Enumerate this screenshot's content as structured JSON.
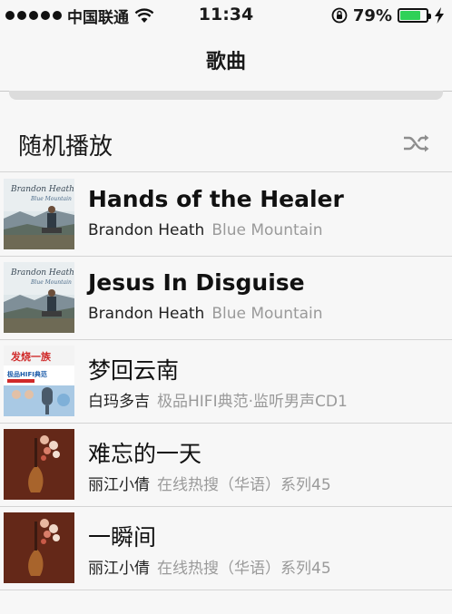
{
  "status_bar": {
    "carrier": "中国联通",
    "time": "11:34",
    "battery_percent": "79%",
    "battery_level": 0.79,
    "signal_dots": 5,
    "icons": [
      "signal-dots-icon",
      "wifi-icon",
      "rotation-lock-icon",
      "battery-icon",
      "charging-bolt-icon"
    ]
  },
  "nav": {
    "title": "歌曲"
  },
  "shuffle": {
    "label": "随机播放",
    "icon": "shuffle-icon"
  },
  "songs": [
    {
      "title": "Hands of the Healer",
      "artist": "Brandon Heath",
      "album": "Blue Mountain",
      "cover": "blue-mountain"
    },
    {
      "title": "Jesus In Disguise",
      "artist": "Brandon Heath",
      "album": "Blue Mountain",
      "cover": "blue-mountain"
    },
    {
      "title": "梦回云南",
      "artist": "白玛多吉",
      "album": "极品HIFI典范·监听男声CD1",
      "cover": "hifi"
    },
    {
      "title": "难忘的一天",
      "artist": "丽江小倩",
      "album": "在线热搜（华语）系列45",
      "cover": "lijiang"
    },
    {
      "title": "一瞬间",
      "artist": "丽江小倩",
      "album": "在线热搜（华语）系列45",
      "cover": "lijiang"
    }
  ],
  "colors": {
    "background": "#f7f7f7",
    "battery_green": "#2fd158",
    "album_text": "#9a9a9a"
  }
}
